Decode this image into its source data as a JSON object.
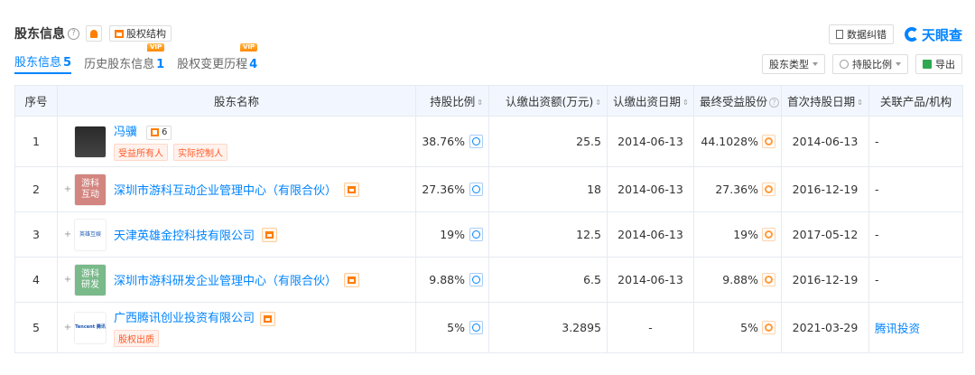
{
  "header": {
    "title": "股东信息",
    "help": "?",
    "structure_btn": "股权结构",
    "feedback_btn": "数据纠错",
    "brand": "天眼查"
  },
  "tabs": [
    {
      "label": "股东信息",
      "count": "5",
      "vip": ""
    },
    {
      "label": "历史股东信息",
      "count": "1",
      "vip": "VIP"
    },
    {
      "label": "股权变更历程",
      "count": "4",
      "vip": "VIP"
    }
  ],
  "tools": {
    "type_filter": "股东类型",
    "ratio_filter": "持股比例",
    "export": "导出"
  },
  "columns": [
    "序号",
    "股东名称",
    "持股比例",
    "认缴出资额(万元)",
    "认缴出资日期",
    "最终受益股份",
    "首次持股日期",
    "关联产品/机构"
  ],
  "rows": [
    {
      "index": "1",
      "name": "冯骥",
      "count": "6",
      "tags": [
        "受益所有人",
        "实际控制人"
      ],
      "ratio": "38.76%",
      "amount": "25.5",
      "date": "2014-06-13",
      "benefit": "44.1028%",
      "first": "2014-06-13",
      "related": "-"
    },
    {
      "index": "2",
      "name": "深圳市游科互动企业管理中心（有限合伙）",
      "logo": "游科\n互动",
      "ratio": "27.36%",
      "amount": "18",
      "date": "2014-06-13",
      "benefit": "27.36%",
      "first": "2016-12-19",
      "related": "-"
    },
    {
      "index": "3",
      "name": "天津英雄金控科技有限公司",
      "logo": "英雄互娱",
      "ratio": "19%",
      "amount": "12.5",
      "date": "2014-06-13",
      "benefit": "19%",
      "first": "2017-05-12",
      "related": "-"
    },
    {
      "index": "4",
      "name": "深圳市游科研发企业管理中心（有限合伙）",
      "logo": "游科\n研发",
      "ratio": "9.88%",
      "amount": "6.5",
      "date": "2014-06-13",
      "benefit": "9.88%",
      "first": "2016-12-19",
      "related": "-"
    },
    {
      "index": "5",
      "name": "广西腾讯创业投资有限公司",
      "logo": "Tencent 腾讯",
      "tags": [
        "股权出质"
      ],
      "ratio": "5%",
      "amount": "3.2895",
      "date": "-",
      "benefit": "5%",
      "first": "2021-03-29",
      "related": "腾讯投资"
    }
  ]
}
